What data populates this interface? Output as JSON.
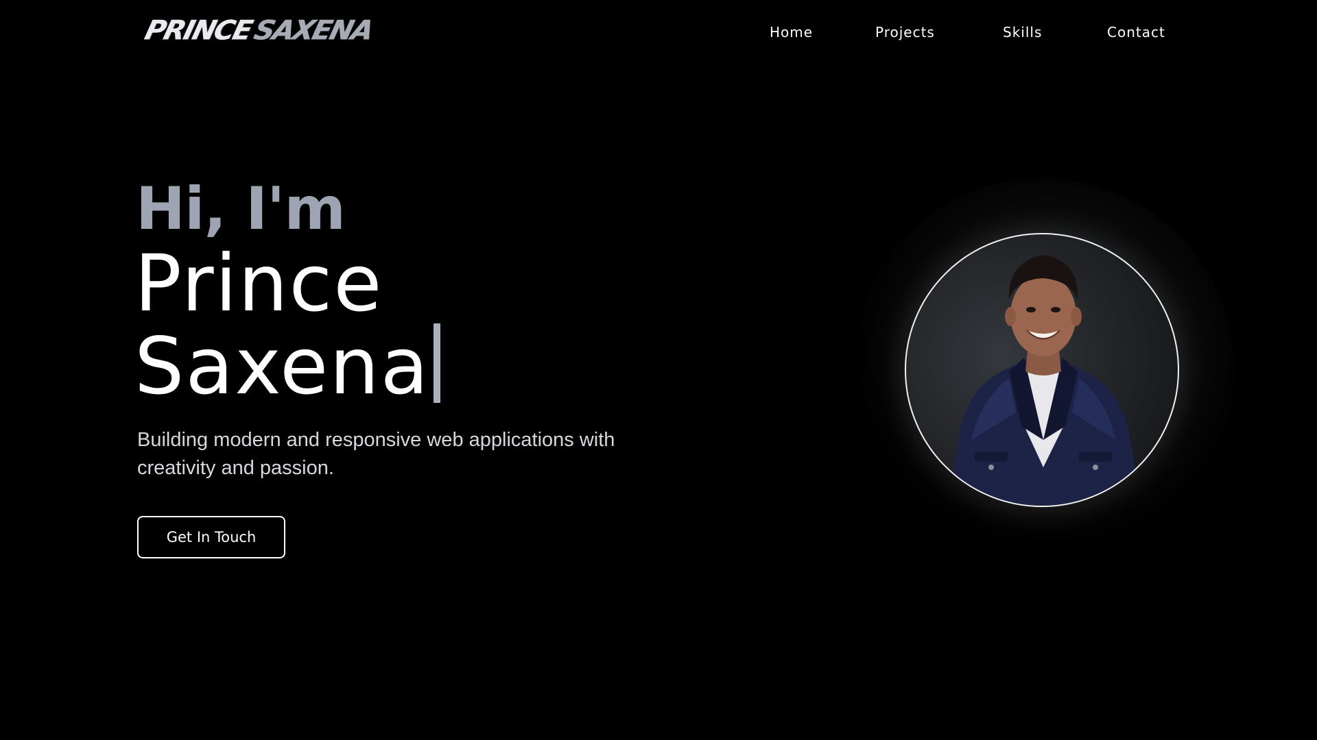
{
  "brand": {
    "logo_first": "PRINCE",
    "logo_second": "SAXENA"
  },
  "nav": {
    "items": [
      {
        "label": "Home"
      },
      {
        "label": "Projects"
      },
      {
        "label": "Skills"
      },
      {
        "label": "Contact"
      }
    ]
  },
  "hero": {
    "greeting": "Hi, I'm",
    "name_line_1": "Prince",
    "name_line_2": "Saxena",
    "tagline": "Building modern and responsive web applications with creativity and passion.",
    "cta_label": "Get In Touch"
  },
  "profile": {
    "image_alt": "Prince Saxena profile photo"
  },
  "colors": {
    "background": "#000000",
    "greeting": "#9ea4b1",
    "text": "#ffffff",
    "tagline": "#d6d8de",
    "cursor": "#aab0bc"
  }
}
